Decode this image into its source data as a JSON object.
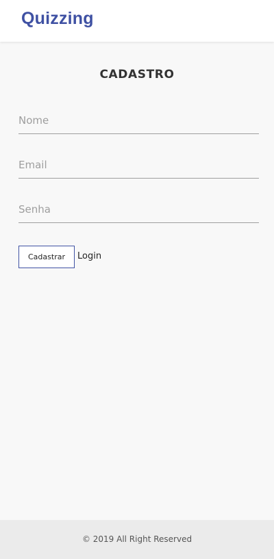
{
  "header": {
    "brand": "Quizzing"
  },
  "form": {
    "title": "CADASTRO",
    "nome_placeholder": "Nome",
    "email_placeholder": "Email",
    "senha_placeholder": "Senha",
    "submit_label": "Cadastrar",
    "login_label": "Login"
  },
  "footer": {
    "copyright": "© 2019 All Right Reserved"
  },
  "colors": {
    "brand": "#3f51a3",
    "background": "#f8f8f8",
    "footer_bg": "#ebebeb"
  }
}
